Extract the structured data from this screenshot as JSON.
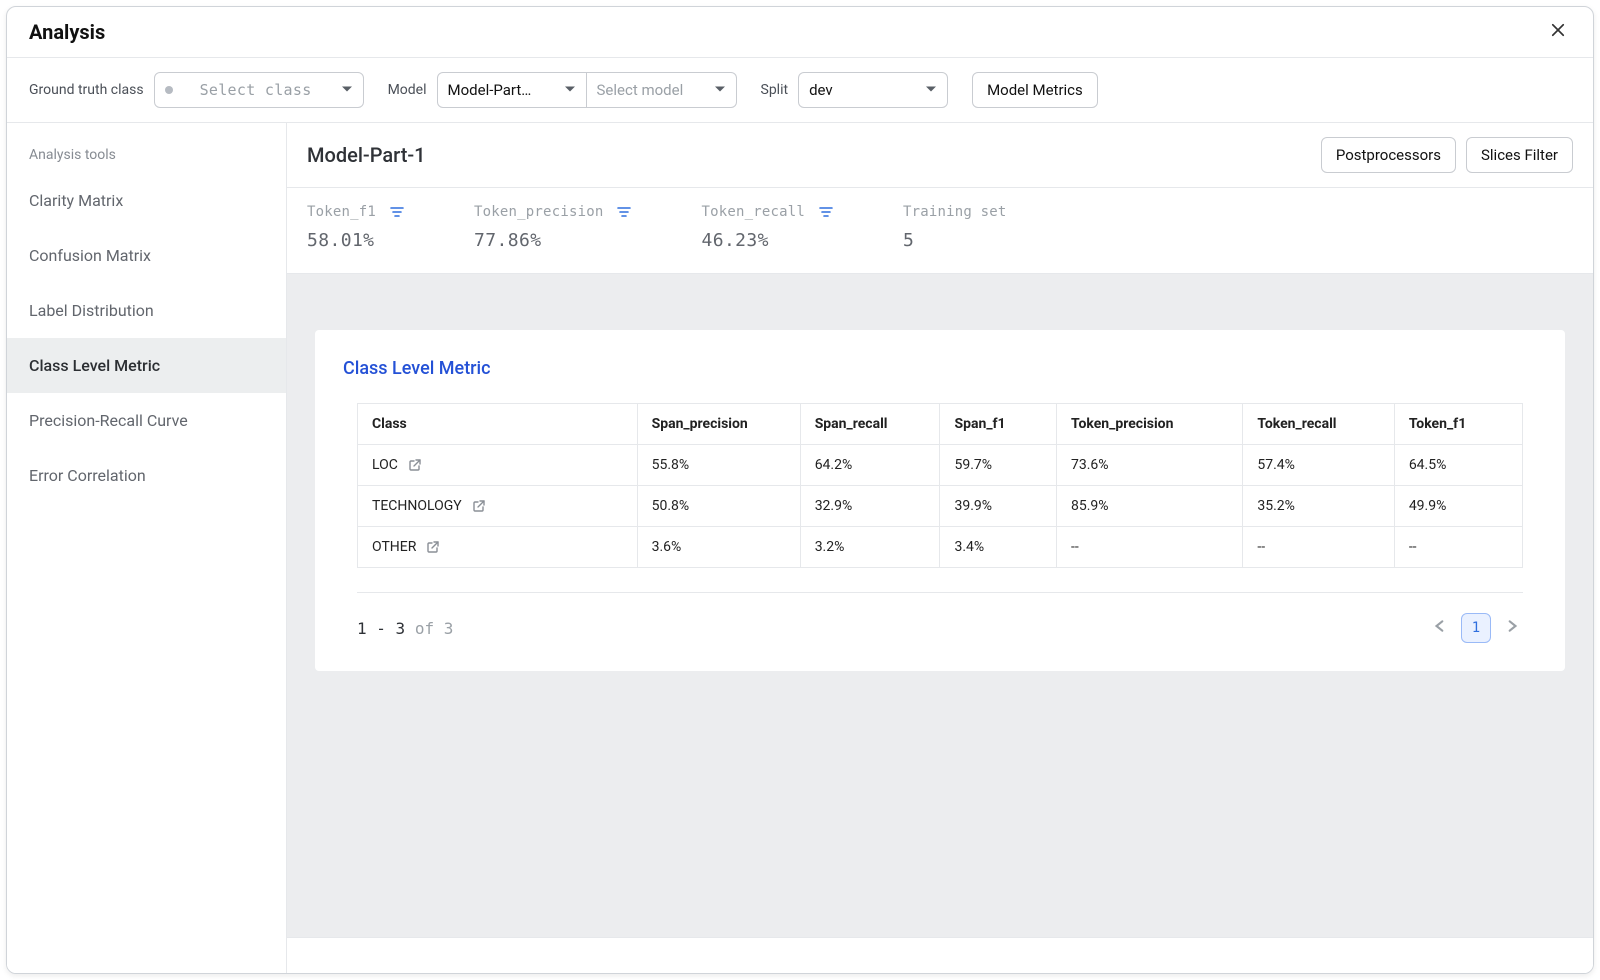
{
  "dialog": {
    "title": "Analysis"
  },
  "filters": {
    "ground_truth_label": "Ground truth class",
    "ground_truth_placeholder": "Select class",
    "model_label": "Model",
    "model_value": "Model-Part…",
    "model_placeholder_b": "Select model",
    "split_label": "Split",
    "split_value": "dev",
    "model_metrics_btn": "Model Metrics"
  },
  "sidebar": {
    "header": "Analysis tools",
    "items": [
      {
        "label": "Clarity Matrix"
      },
      {
        "label": "Confusion Matrix"
      },
      {
        "label": "Label Distribution"
      },
      {
        "label": "Class Level Metric"
      },
      {
        "label": "Precision-Recall Curve"
      },
      {
        "label": "Error Correlation"
      }
    ],
    "active_index": 3
  },
  "main": {
    "title": "Model-Part-1",
    "buttons": {
      "postprocessors": "Postprocessors",
      "slices_filter": "Slices Filter"
    },
    "metrics": [
      {
        "label": "Token_f1",
        "value": "58.01%",
        "sortable": true
      },
      {
        "label": "Token_precision",
        "value": "77.86%",
        "sortable": true
      },
      {
        "label": "Token_recall",
        "value": "46.23%",
        "sortable": true
      },
      {
        "label": "Training set",
        "value": "5",
        "sortable": false
      }
    ],
    "card": {
      "title": "Class Level Metric",
      "columns": [
        "Class",
        "Span_precision",
        "Span_recall",
        "Span_f1",
        "Token_precision",
        "Token_recall",
        "Token_f1"
      ],
      "col_widths": [
        "24%",
        "14%",
        "12%",
        "10%",
        "16%",
        "13%",
        "11%"
      ],
      "rows": [
        {
          "class": "LOC",
          "span_precision": "55.8%",
          "span_recall": "64.2%",
          "span_f1": "59.7%",
          "token_precision": "73.6%",
          "token_recall": "57.4%",
          "token_f1": "64.5%"
        },
        {
          "class": "TECHNOLOGY",
          "span_precision": "50.8%",
          "span_recall": "32.9%",
          "span_f1": "39.9%",
          "token_precision": "85.9%",
          "token_recall": "35.2%",
          "token_f1": "49.9%"
        },
        {
          "class": "OTHER",
          "span_precision": "3.6%",
          "span_recall": "3.2%",
          "span_f1": "3.4%",
          "token_precision": "--",
          "token_recall": "--",
          "token_f1": "--"
        }
      ],
      "pagination": {
        "range": "1 - 3",
        "of_label": "of",
        "total": "3",
        "current_page": "1"
      }
    }
  }
}
